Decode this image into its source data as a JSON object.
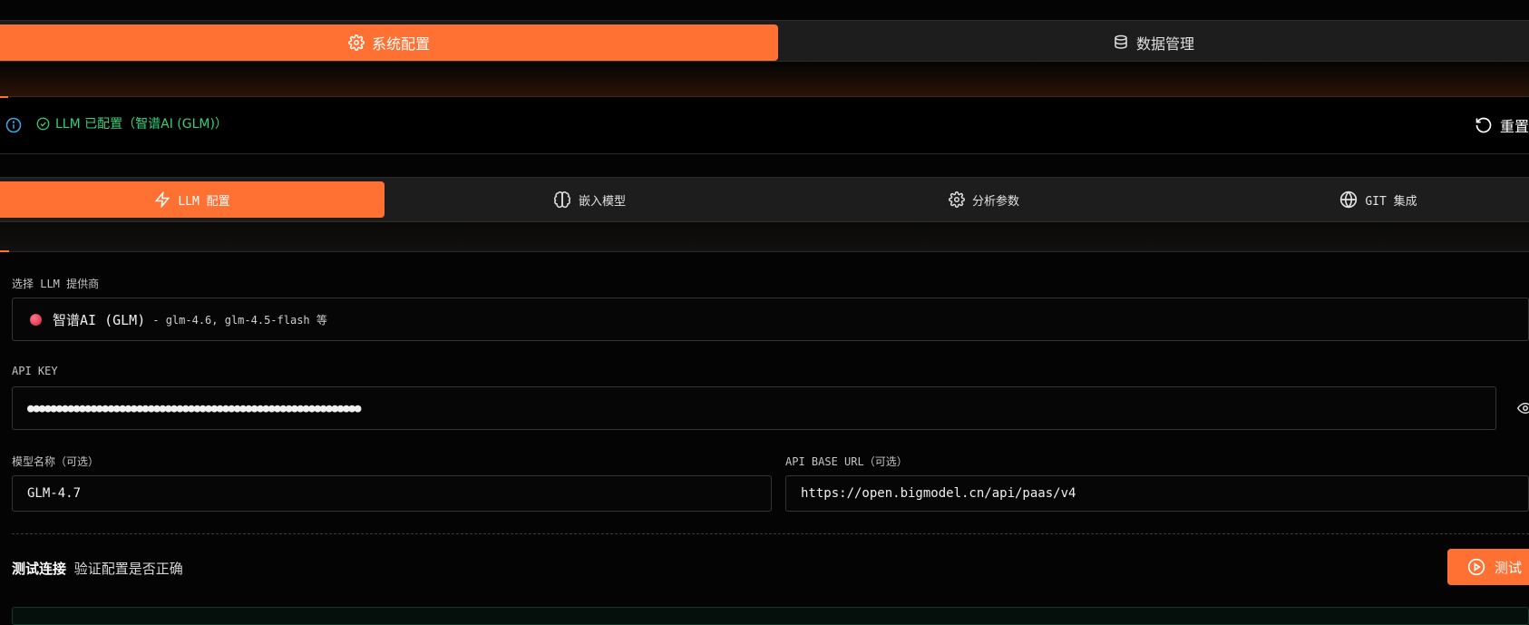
{
  "main_tabs": [
    {
      "label": "系统配置",
      "icon": "gear-icon",
      "active": true
    },
    {
      "label": "数据管理",
      "icon": "database-icon",
      "active": false
    }
  ],
  "status": {
    "text": "LLM 已配置（智谱AI (GLM)）",
    "reset_label": "重置"
  },
  "sub_tabs": [
    {
      "label": "LLM 配置",
      "icon": "bolt-icon",
      "active": true
    },
    {
      "label": "嵌入模型",
      "icon": "brain-icon",
      "active": false
    },
    {
      "label": "分析参数",
      "icon": "gear-icon",
      "active": false
    },
    {
      "label": "GIT 集成",
      "icon": "globe-icon",
      "active": false
    }
  ],
  "provider": {
    "label": "选择 LLM 提供商",
    "selected_name": "智谱AI (GLM)",
    "selected_desc": "- glm-4.6, glm-4.5-flash 等",
    "dot_color": "#e8344a"
  },
  "api_key": {
    "label": "API KEY",
    "value": "●●●●●●●●●●●●●●●●●●●●●●●●●●●●●●●●●●●●●●●●●●●●●●●●●●●●●●●●●●"
  },
  "model_name": {
    "label": "模型名称（可选）",
    "value": "GLM-4.7"
  },
  "api_base_url": {
    "label": "API BASE URL（可选）",
    "value": "https://open.bigmodel.cn/api/paas/v4"
  },
  "test": {
    "title": "测试连接",
    "subtitle": "验证配置是否正确",
    "button_label": "测试"
  },
  "colors": {
    "accent": "#ff7133",
    "success": "#34d07a",
    "info": "#3fa7e8"
  }
}
